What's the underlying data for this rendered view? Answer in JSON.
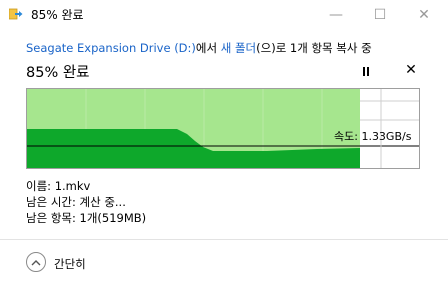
{
  "window": {
    "title": "85% 완료",
    "minimize_glyph": "—",
    "maximize_glyph": "☐",
    "close_glyph": "✕"
  },
  "copy": {
    "source": "Seagate Expansion Drive (D:)",
    "from_text": "에서 ",
    "destination": "새 폴더",
    "rest": "(으)로 1개 항목 복사 중",
    "progress_title": "85% 완료",
    "progress_fraction": 0.85,
    "speed": "속도: 1.33GB/s"
  },
  "details": {
    "name": "이름: 1.mkv",
    "time_remaining": "남은 시간: 계산 중...",
    "items_remaining": "남은 항목: 1개(519MB)"
  },
  "footer": {
    "collapse_label": "간단히"
  },
  "colors": {
    "graph_fill_light": "#a6e68e",
    "graph_fill_dark": "#0ea82b",
    "graph_grid": "#b9eba5",
    "link": "#1a64c8"
  }
}
